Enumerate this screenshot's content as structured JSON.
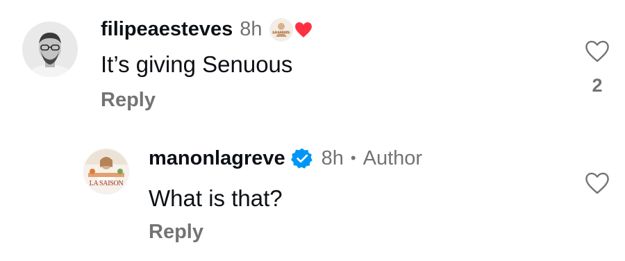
{
  "comments": [
    {
      "username": "filipeaesteves",
      "time": "8h",
      "text": "It’s giving Senuous",
      "reply_label": "Reply",
      "like_count": "2",
      "creator_liked_badge_text": "LA SAISON"
    },
    {
      "username": "manonlagreve",
      "time": "8h",
      "separator": "•",
      "author_label": "Author",
      "text": "What is that?",
      "reply_label": "Reply",
      "avatar_text": "LA SAISON"
    }
  ],
  "icons": {
    "like": "heart-outline-icon",
    "verified": "verified-badge-icon",
    "creator_liked": "red-heart-icon"
  },
  "colors": {
    "verified_blue": "#0095f6",
    "heart_red": "#ff3040",
    "secondary_text": "#737373",
    "primary_text": "#0c1014"
  }
}
